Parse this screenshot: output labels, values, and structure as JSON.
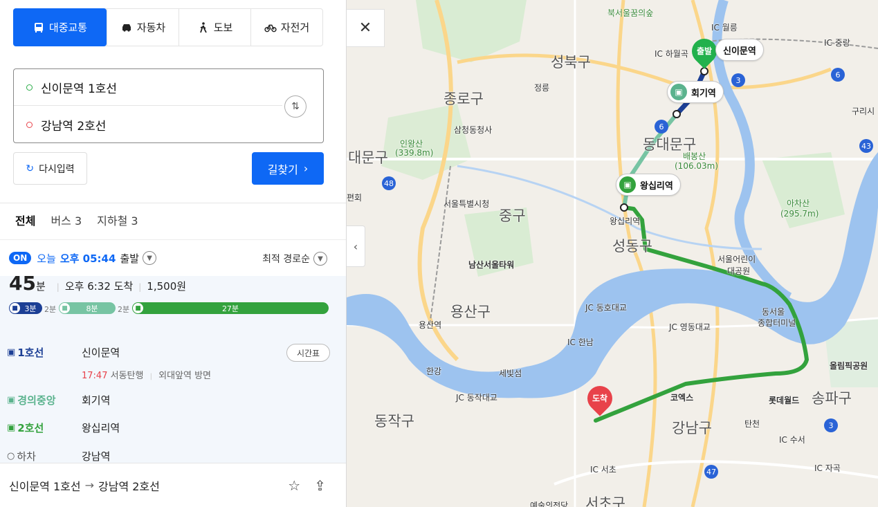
{
  "modes": [
    {
      "label": "대중교통",
      "icon": "bus-icon",
      "active": true
    },
    {
      "label": "자동차",
      "icon": "car-icon",
      "active": false
    },
    {
      "label": "도보",
      "icon": "walk-icon",
      "active": false
    },
    {
      "label": "자전거",
      "icon": "bicycle-icon",
      "active": false
    }
  ],
  "origin": "신이문역 1호선",
  "destination": "강남역 2호선",
  "reset_label": "다시입력",
  "search_label": "길찾기",
  "tabs": [
    {
      "label": "전체",
      "active": true
    },
    {
      "label": "버스 3",
      "active": false
    },
    {
      "label": "지하철 3",
      "active": false
    }
  ],
  "depart": {
    "badge": "ON",
    "today": "오늘",
    "time": "오후 05:44",
    "suffix": "출발",
    "sort": "최적 경로순"
  },
  "summary": {
    "duration": "45",
    "unit": "분",
    "arrival": "오후 6:32 도착",
    "fare": "1,500원"
  },
  "bar": {
    "segments": [
      {
        "label": "3분",
        "color": "#1c3f95"
      },
      {
        "label": "8분",
        "color": "#77c4a3"
      },
      {
        "label": "27분",
        "color": "#33a23d"
      }
    ],
    "walks": [
      "2분",
      "2분"
    ]
  },
  "steps": [
    {
      "line": "1호선",
      "station": "신이문역",
      "color": "#1c3f95"
    },
    {
      "line": "경의중앙",
      "station": "회기역",
      "color": "#5bb38e"
    },
    {
      "line": "2호선",
      "station": "왕십리역",
      "color": "#33a23d"
    },
    {
      "line": "하차",
      "station": "강남역",
      "color": "#555555"
    }
  ],
  "first_step_info": {
    "time": "17:47",
    "direction": "서동탄행",
    "exit": "외대앞역 방면"
  },
  "timetable_label": "시간표",
  "footer": {
    "origin": "신이문역 1호선",
    "arrow": "→",
    "destination": "강남역 2호선"
  },
  "map": {
    "districts": [
      "성북구",
      "종로구",
      "동대문구",
      "대문구",
      "중구",
      "성동구",
      "용산구",
      "동작구",
      "강남구",
      "송파구",
      "서초구"
    ],
    "places": [
      "북서울꿈의숲",
      "정릉",
      "삼청동청사",
      "인왕산",
      "(339.8m)",
      "서울특별시청",
      "남산서울타워",
      "용산역",
      "한강",
      "세빛섬",
      "코엑스",
      "롯데월드",
      "올림픽공원",
      "배봉산",
      "(106.03m)",
      "아차산",
      "(295.7m)",
      "서울어린이",
      "대공원",
      "동서울",
      "종합터미널",
      "왕십리역",
      "구리시",
      "편회",
      "탄천",
      "예술의전당"
    ],
    "ic_labels": [
      "IC 월릉",
      "IC 하월곡",
      "IC 중랑",
      "IC 한남",
      "IC 서초",
      "IC 수서",
      "IC 자곡"
    ],
    "jc_labels": [
      "JC 동호대교",
      "JC 영동대교",
      "JC 동작대교"
    ],
    "highway_numbers": [
      "3",
      "6",
      "6",
      "43",
      "48",
      "47",
      "3"
    ],
    "start_pin": "출발",
    "end_pin": "도착",
    "station_labels": [
      {
        "name": "신이문역",
        "color": "#22b14c"
      },
      {
        "name": "회기역",
        "color": "#5bb38e"
      },
      {
        "name": "왕십리역",
        "color": "#33a23d"
      }
    ]
  }
}
